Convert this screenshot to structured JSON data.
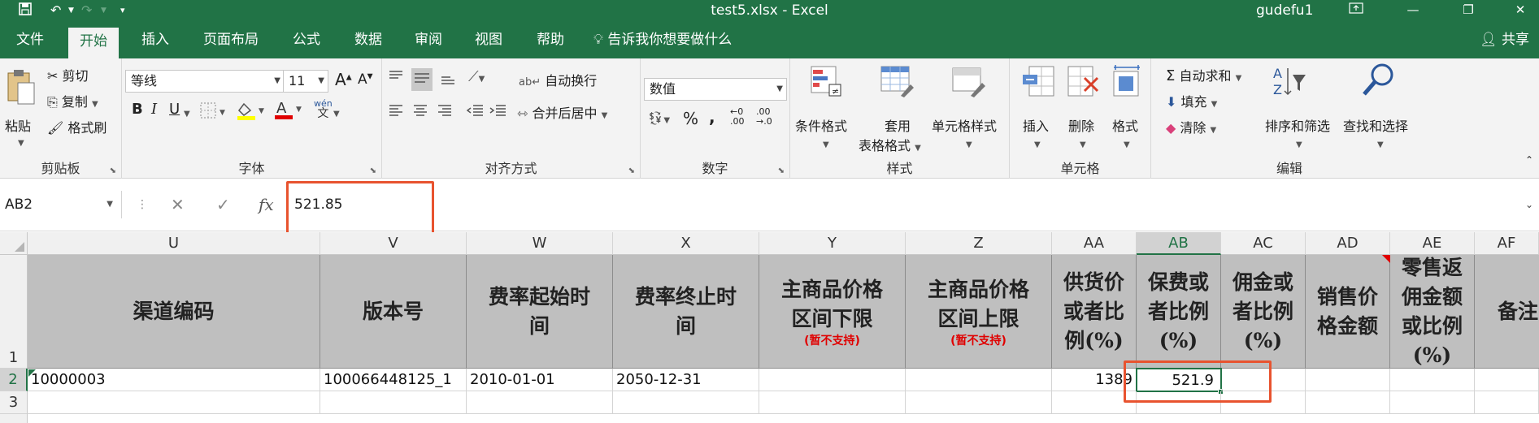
{
  "window": {
    "title": "test5.xlsx  -  Excel",
    "user": "gudefu1"
  },
  "tabs": [
    {
      "label": "文件"
    },
    {
      "label": "开始"
    },
    {
      "label": "插入"
    },
    {
      "label": "页面布局"
    },
    {
      "label": "公式"
    },
    {
      "label": "数据"
    },
    {
      "label": "审阅"
    },
    {
      "label": "视图"
    },
    {
      "label": "帮助"
    }
  ],
  "tell_me": "告诉我你想要做什么",
  "share": "共享",
  "ribbon": {
    "clipboard": {
      "label": "剪贴板",
      "paste": "粘贴",
      "cut": "剪切",
      "copy": "复制",
      "format_painter": "格式刷"
    },
    "font": {
      "label": "字体",
      "name": "等线",
      "size": "11",
      "bold": "B",
      "italic": "I",
      "underline": "U",
      "phonetic": "wén"
    },
    "alignment": {
      "label": "对齐方式",
      "wrap": "自动换行",
      "merge": "合并后居中"
    },
    "number": {
      "label": "数字",
      "format": "数值",
      "percent": "%",
      "comma": ","
    },
    "styles": {
      "label": "样式",
      "conditional": "条件格式",
      "table_line1": "套用",
      "table_line2": "表格格式",
      "cell_styles": "单元格样式"
    },
    "cells": {
      "label": "单元格",
      "insert": "插入",
      "delete": "删除",
      "format": "格式"
    },
    "editing": {
      "label": "编辑",
      "autosum": "自动求和",
      "fill": "填充",
      "clear": "清除",
      "sort": "排序和筛选",
      "find": "查找和选择"
    }
  },
  "formula_bar": {
    "name_box": "AB2",
    "fx": "fx",
    "value": "521.85"
  },
  "grid": {
    "columns": [
      "U",
      "V",
      "W",
      "X",
      "Y",
      "Z",
      "AA",
      "AB",
      "AC",
      "AD",
      "AE",
      "AF"
    ],
    "selected_column": "AB",
    "rows": [
      "1",
      "2",
      "3"
    ],
    "selected_row": "2",
    "headers": [
      {
        "col": "U",
        "lines": [
          "渠道编码"
        ]
      },
      {
        "col": "V",
        "lines": [
          "版本号"
        ]
      },
      {
        "col": "W",
        "lines": [
          "费率起始时",
          "间"
        ]
      },
      {
        "col": "X",
        "lines": [
          "费率终止时",
          "间"
        ]
      },
      {
        "col": "Y",
        "lines": [
          "主商品价格",
          "区间下限"
        ],
        "note": "(暂不支持)"
      },
      {
        "col": "Z",
        "lines": [
          "主商品价格",
          "区间上限"
        ],
        "note": "(暂不支持)"
      },
      {
        "col": "AA",
        "lines": [
          "供货价",
          "或者比",
          "例(%)"
        ]
      },
      {
        "col": "AB",
        "lines": [
          "保费或",
          "者比例",
          "(%)"
        ]
      },
      {
        "col": "AC",
        "lines": [
          "佣金或",
          "者比例",
          "(%)"
        ]
      },
      {
        "col": "AD",
        "lines": [
          "销售价",
          "格金额"
        ]
      },
      {
        "col": "AE",
        "lines": [
          "零售返",
          "佣金额",
          "或比例",
          "(%)"
        ]
      },
      {
        "col": "AF",
        "lines": [
          "备注"
        ]
      }
    ],
    "row2": {
      "U": "10000003",
      "V": "100066448125_1",
      "W": "2010-01-01",
      "X": "2050-12-31",
      "AA": "1389",
      "AB": "521.9"
    }
  }
}
